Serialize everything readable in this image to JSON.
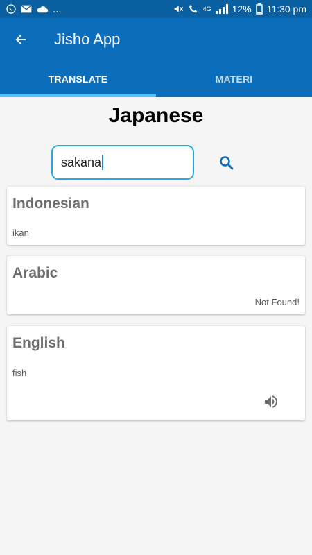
{
  "status": {
    "battery": "12%",
    "time": "11:30 pm",
    "network": "4G",
    "dots": "..."
  },
  "appbar": {
    "title": "Jisho App"
  },
  "tabs": [
    {
      "label": "TRANSLATE",
      "active": true
    },
    {
      "label": "MATERI",
      "active": false
    }
  ],
  "main": {
    "heading": "Japanese",
    "search": {
      "value": "sakana"
    }
  },
  "cards": [
    {
      "title": "Indonesian",
      "text": "ikan"
    },
    {
      "title": "Arabic",
      "text": "Not Found!"
    },
    {
      "title": "English",
      "text": "fish"
    }
  ]
}
